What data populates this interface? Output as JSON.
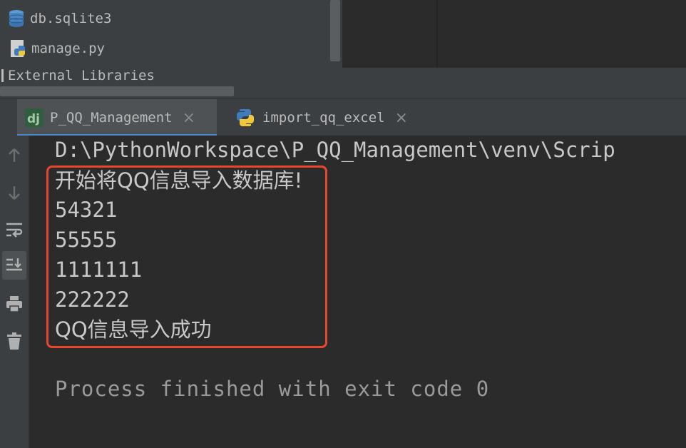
{
  "project_tree": {
    "items": [
      {
        "label": "db.sqlite3",
        "icon": "database-icon"
      },
      {
        "label": "manage.py",
        "icon": "python-file-icon"
      },
      {
        "label": "External Libraries",
        "icon": "library-icon"
      }
    ]
  },
  "tabs": [
    {
      "label": "P_QQ_Management",
      "icon": "django-icon",
      "active": true
    },
    {
      "label": "import_qq_excel",
      "icon": "python-icon",
      "active": false
    }
  ],
  "tab_close_glyph": "×",
  "console": {
    "path_line": "D:\\PythonWorkspace\\P_QQ_Management\\venv\\Scrip",
    "output_lines": [
      "开始将QQ信息导入数据库!",
      "54321",
      "55555",
      "1111111",
      "222222",
      "QQ信息导入成功"
    ],
    "exit_line": "Process finished with exit code 0"
  },
  "toolstrip": [
    {
      "icon": "arrow-up-icon"
    },
    {
      "icon": "arrow-down-icon"
    },
    {
      "icon": "soft-wrap-icon"
    },
    {
      "icon": "scroll-to-end-icon",
      "active": true
    },
    {
      "icon": "print-icon"
    },
    {
      "icon": "trash-icon"
    }
  ],
  "colors": {
    "highlight_border": "#e8472f",
    "console_text": "#c8c8c8",
    "background": "#2b2b2b",
    "panel": "#3c3f41"
  }
}
